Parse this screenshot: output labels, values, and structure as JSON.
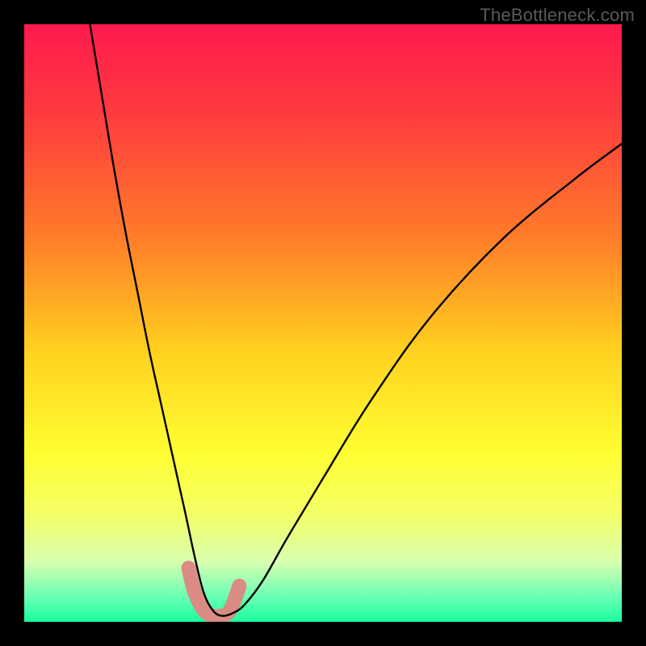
{
  "watermark": "TheBottleneck.com",
  "chart_data": {
    "type": "line",
    "title": "",
    "xlabel": "",
    "ylabel": "",
    "xlim": [
      0,
      100
    ],
    "ylim": [
      0,
      100
    ],
    "grid": false,
    "legend": false,
    "annotations": [],
    "background_gradient_stops": [
      {
        "offset": 0.0,
        "color": "#ff1a4d"
      },
      {
        "offset": 0.15,
        "color": "#ff3b3f"
      },
      {
        "offset": 0.35,
        "color": "#ff7a2a"
      },
      {
        "offset": 0.55,
        "color": "#ffd21f"
      },
      {
        "offset": 0.72,
        "color": "#ffff33"
      },
      {
        "offset": 0.82,
        "color": "#f4ff66"
      },
      {
        "offset": 0.9,
        "color": "#d8ffb0"
      },
      {
        "offset": 0.96,
        "color": "#66ffb3"
      },
      {
        "offset": 1.0,
        "color": "#19ff9e"
      }
    ],
    "series": [
      {
        "name": "bottleneck-curve",
        "color": "#000000",
        "x": [
          11,
          13,
          15,
          17,
          19,
          21,
          23,
          25,
          27,
          28.5,
          30,
          31.5,
          33,
          35,
          37,
          40,
          44,
          50,
          58,
          68,
          80,
          92,
          100
        ],
        "y": [
          100,
          88,
          76,
          65,
          55,
          45,
          36,
          27,
          18,
          11,
          5,
          2,
          1,
          1.5,
          3,
          7,
          14,
          24,
          37,
          51,
          64,
          74,
          80
        ]
      },
      {
        "name": "valley-highlight",
        "color": "#d98b84",
        "x": [
          27.5,
          28.5,
          30,
          31.5,
          33,
          34.5,
          36
        ],
        "y": [
          9,
          5,
          2,
          1,
          1,
          2,
          6
        ]
      }
    ]
  }
}
